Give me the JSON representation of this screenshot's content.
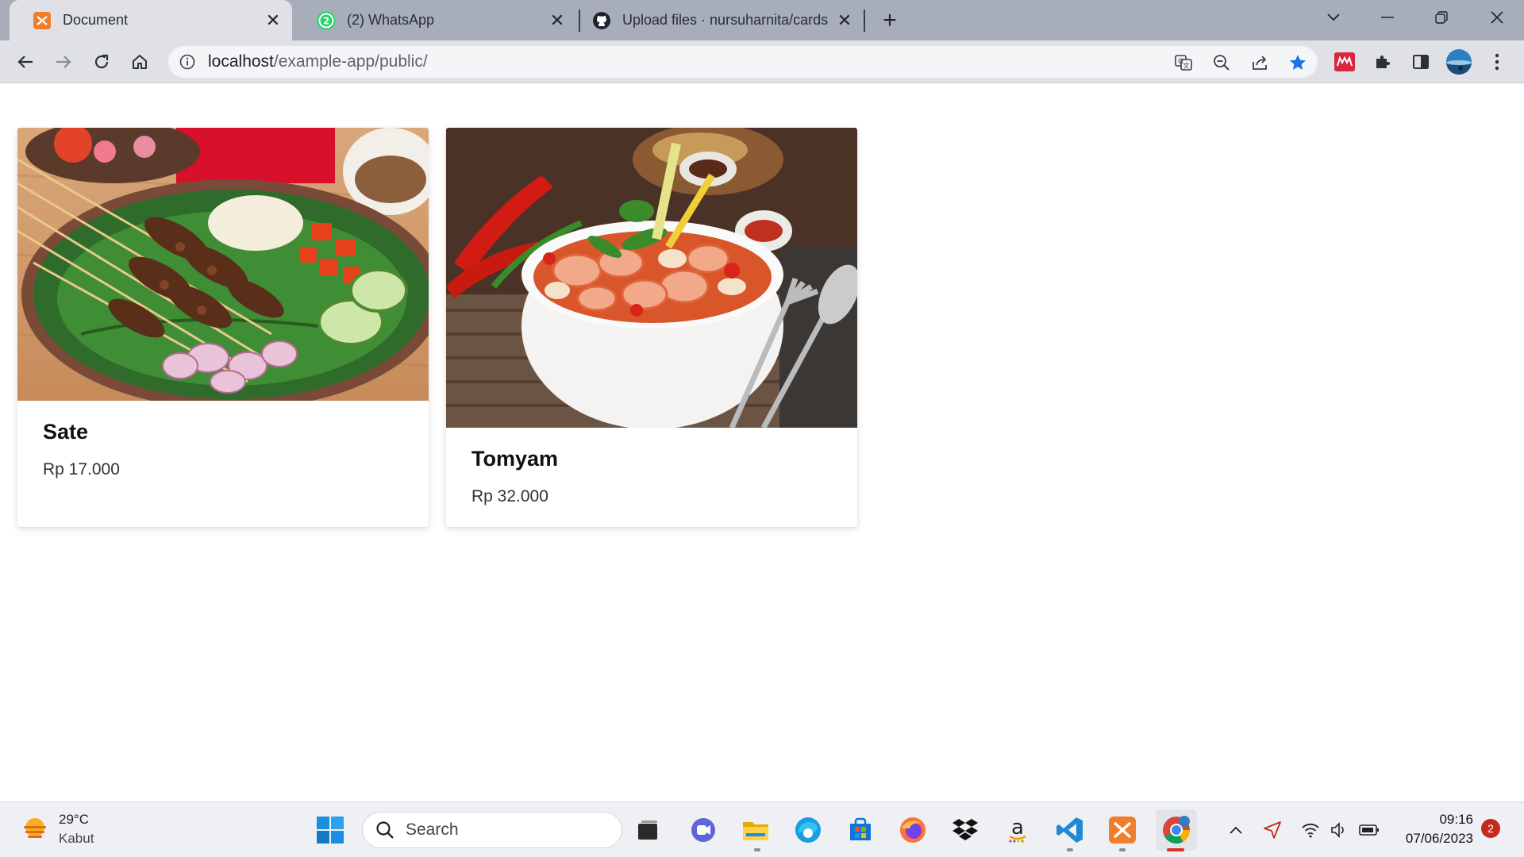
{
  "browser": {
    "tabs": [
      {
        "title": "Document",
        "icon": "xampp-icon"
      },
      {
        "title": "(2) WhatsApp",
        "icon": "whatsapp-icon",
        "badge": "2"
      },
      {
        "title": "Upload files · nursuharnita/cards",
        "icon": "github-icon"
      }
    ],
    "url_host": "localhost",
    "url_path": "/example-app/public/"
  },
  "cards": [
    {
      "title": "Sate",
      "price": "Rp 17.000",
      "image": "sate-photo"
    },
    {
      "title": "Tomyam",
      "price": "Rp 32.000",
      "image": "tomyam-photo"
    }
  ],
  "taskbar": {
    "weather_temp": "29°C",
    "weather_cond": "Kabut",
    "search_label": "Search",
    "time": "09:16",
    "date": "07/06/2023",
    "notification_count": "2"
  },
  "colors": {
    "tabstrip": "#a7adb9",
    "toolbar": "#dfe1e6",
    "bookmark_star": "#1a73e8"
  }
}
